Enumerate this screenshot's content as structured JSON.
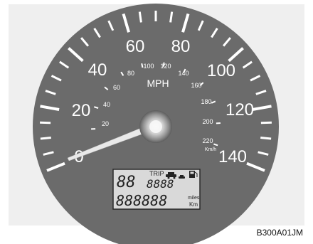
{
  "speedometer": {
    "mph_scale": [
      "0",
      "20",
      "40",
      "60",
      "80",
      "100",
      "120",
      "140"
    ],
    "mph_unit": "MPH",
    "kmh_scale": [
      "20",
      "40",
      "60",
      "80",
      "100",
      "120",
      "140",
      "160",
      "180",
      "200",
      "220"
    ],
    "kmh_unit": "Km/h"
  },
  "lcd": {
    "trip_label": "TRIP",
    "trip_digits": "8888",
    "gear_digits": "88",
    "odometer_digits": "888888",
    "unit_miles": "miles",
    "unit_km": "Km"
  },
  "figure_code": "B300A01JM",
  "colors": {
    "dial": "#6b6b6b",
    "marking": "#ffffff",
    "lcd_background": "#d9d9d9",
    "lcd_segments": "#222222"
  }
}
